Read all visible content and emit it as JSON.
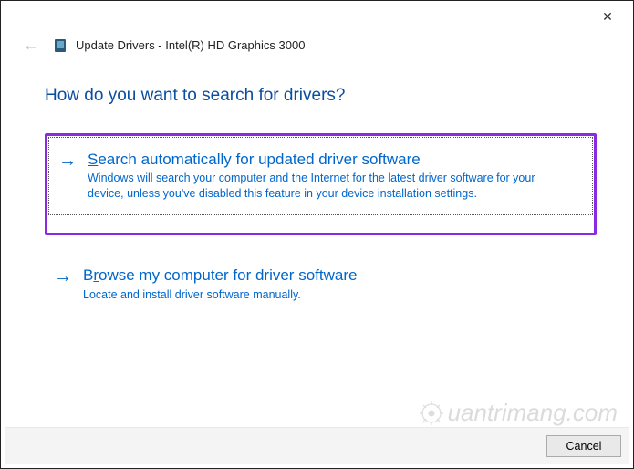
{
  "titlebar": {
    "close_glyph": "✕"
  },
  "header": {
    "back_glyph": "←",
    "window_title": "Update Drivers - Intel(R) HD Graphics 3000"
  },
  "main": {
    "heading": "How do you want to search for drivers?",
    "options": [
      {
        "arrow": "→",
        "accel": "S",
        "title_rest": "earch automatically for updated driver software",
        "desc": "Windows will search your computer and the Internet for the latest driver software for your device, unless you've disabled this feature in your device installation settings."
      },
      {
        "arrow": "→",
        "accel": "r",
        "title_pre": "B",
        "title_rest": "owse my computer for driver software",
        "desc": "Locate and install driver software manually."
      }
    ]
  },
  "footer": {
    "cancel_label": "Cancel"
  },
  "watermark": {
    "text": "uantrimang.com"
  }
}
